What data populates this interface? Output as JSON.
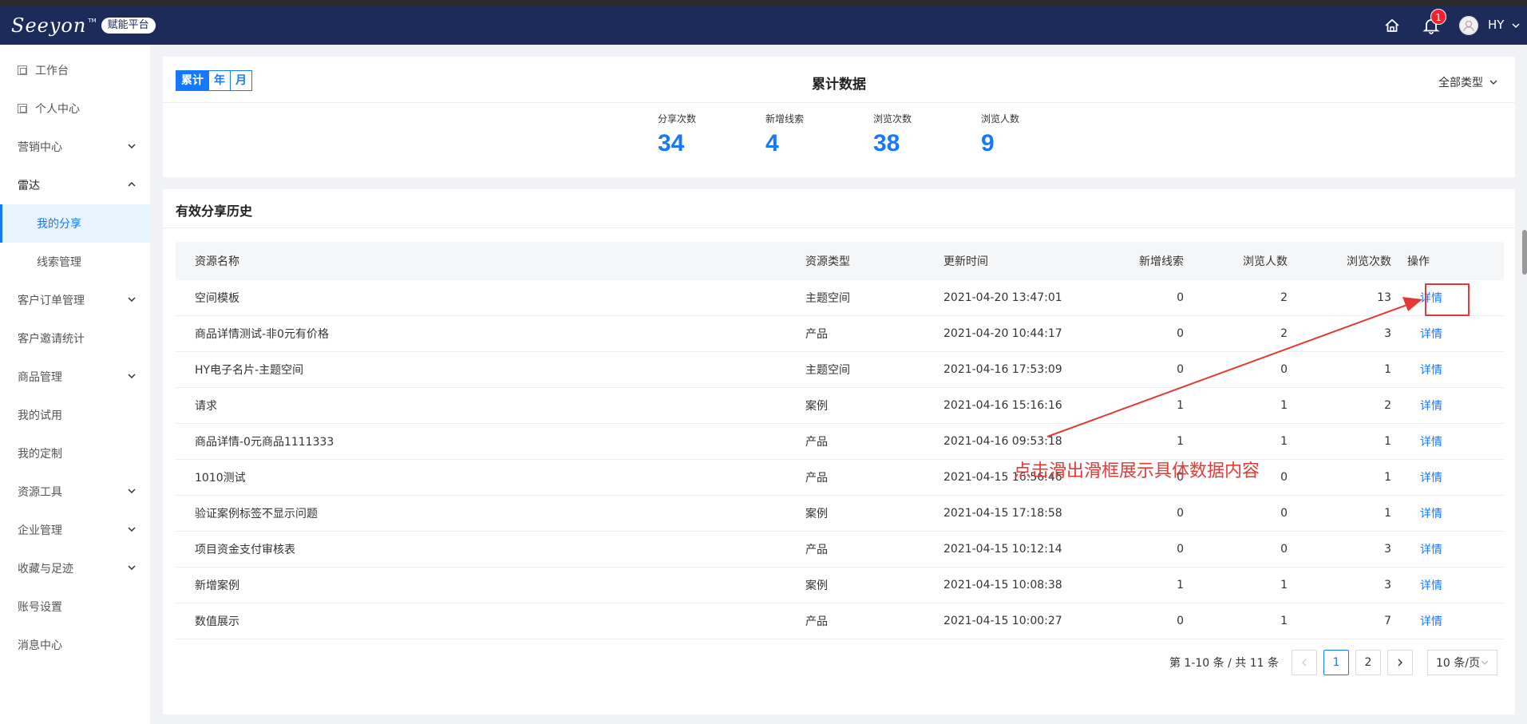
{
  "app": {
    "logo_text": "Seeyon",
    "logo_tm": "TM",
    "platform_badge": "赋能平台",
    "notification_count": "1",
    "user_name": "HY",
    "brand_color": "#1d2b5b",
    "accent_color": "#1677ff"
  },
  "sidebar": {
    "items": [
      {
        "label": "工作台",
        "icon": "workbench-icon"
      },
      {
        "label": "个人中心",
        "icon": "personal-icon"
      },
      {
        "label": "营销中心"
      },
      {
        "label": "雷达"
      },
      {
        "label": "我的分享"
      },
      {
        "label": "线索管理"
      },
      {
        "label": "客户订单管理"
      },
      {
        "label": "客户邀请统计"
      },
      {
        "label": "商品管理"
      },
      {
        "label": "我的试用"
      },
      {
        "label": "我的定制"
      },
      {
        "label": "资源工具"
      },
      {
        "label": "企业管理"
      },
      {
        "label": "收藏与足迹"
      },
      {
        "label": "账号设置"
      },
      {
        "label": "消息中心"
      }
    ]
  },
  "summary": {
    "tabs": [
      "累计",
      "年",
      "月"
    ],
    "title": "累计数据",
    "type_filter": "全部类型",
    "stats": [
      {
        "label": "分享次数",
        "value": "34"
      },
      {
        "label": "新增线索",
        "value": "4"
      },
      {
        "label": "浏览次数",
        "value": "38"
      },
      {
        "label": "浏览人数",
        "value": "9"
      }
    ]
  },
  "history": {
    "title": "有效分享历史",
    "columns": [
      "资源名称",
      "资源类型",
      "更新时间",
      "新增线索",
      "浏览人数",
      "浏览次数",
      "操作"
    ],
    "rows": [
      {
        "name": "空间模板",
        "type": "主题空间",
        "time": "2021-04-20 13:47:01",
        "leads": "0",
        "visitors": "2",
        "views": "13",
        "action": "详情"
      },
      {
        "name": "商品详情测试-非0元有价格",
        "type": "产品",
        "time": "2021-04-20 10:44:17",
        "leads": "0",
        "visitors": "2",
        "views": "3",
        "action": "详情"
      },
      {
        "name": "HY电子名片-主题空间",
        "type": "主题空间",
        "time": "2021-04-16 17:53:09",
        "leads": "0",
        "visitors": "0",
        "views": "1",
        "action": "详情"
      },
      {
        "name": "请求",
        "type": "案例",
        "time": "2021-04-16 15:16:16",
        "leads": "1",
        "visitors": "1",
        "views": "2",
        "action": "详情"
      },
      {
        "name": "商品详情-0元商品1111333",
        "type": "产品",
        "time": "2021-04-16 09:53:18",
        "leads": "1",
        "visitors": "1",
        "views": "1",
        "action": "详情"
      },
      {
        "name": "1010测试",
        "type": "产品",
        "time": "2021-04-15 16:56:46",
        "leads": "0",
        "visitors": "0",
        "views": "1",
        "action": "详情"
      },
      {
        "name": "验证案例标签不显示问题",
        "type": "案例",
        "time": "2021-04-15 17:18:58",
        "leads": "0",
        "visitors": "0",
        "views": "1",
        "action": "详情"
      },
      {
        "name": "项目资金支付审核表",
        "type": "产品",
        "time": "2021-04-15 10:12:14",
        "leads": "0",
        "visitors": "0",
        "views": "3",
        "action": "详情"
      },
      {
        "name": "新增案例",
        "type": "案例",
        "time": "2021-04-15 10:08:38",
        "leads": "1",
        "visitors": "1",
        "views": "3",
        "action": "详情"
      },
      {
        "name": "数值展示",
        "type": "产品",
        "time": "2021-04-15 10:00:27",
        "leads": "0",
        "visitors": "1",
        "views": "7",
        "action": "详情"
      }
    ],
    "pagination": {
      "info": "第 1-10 条 / 共 11 条",
      "pages": [
        "1",
        "2"
      ],
      "page_size": "10 条/页"
    }
  },
  "annotation": {
    "text": "点击滑出滑框展示具体数据内容",
    "color": "#e53935"
  }
}
